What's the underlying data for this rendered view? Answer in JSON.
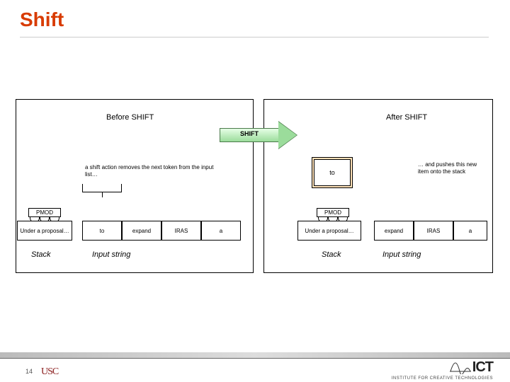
{
  "title": "Shift",
  "arrow_label": "SHIFT",
  "left": {
    "header": "Before SHIFT",
    "desc": "a shift action removes the next token from the input list…",
    "pmod": "PMOD",
    "stack_cell": "Under a proposal…",
    "input": [
      "to",
      "expand",
      "IRAS",
      "a"
    ],
    "stack_label": "Stack",
    "input_label": "Input string"
  },
  "right": {
    "header": "After SHIFT",
    "desc": "… and pushes this new item onto the stack",
    "to_cell": "to",
    "pmod": "PMOD",
    "stack_cell": "Under a proposal…",
    "input": [
      "expand",
      "IRAS",
      "a"
    ],
    "stack_label": "Stack",
    "input_label": "Input string"
  },
  "footer": {
    "page": "14",
    "usc": "USC",
    "ict": "ICT",
    "ict_sub": "INSTITUTE FOR CREATIVE TECHNOLOGIES"
  }
}
